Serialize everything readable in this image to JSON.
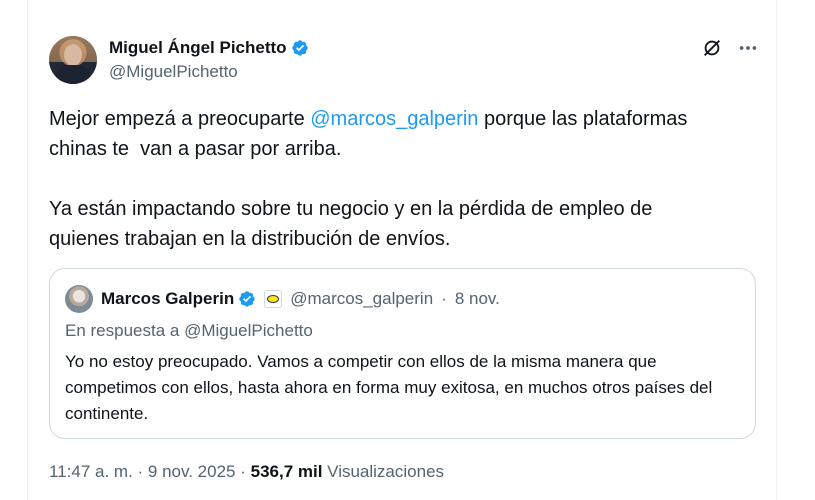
{
  "author": {
    "display_name": "Miguel Ángel Pichetto",
    "handle": "@MiguelPichetto"
  },
  "tweet": {
    "text_part1": "Mejor empezá a preocuparte ",
    "mention": "@marcos_galperin",
    "text_part2": " porque las plataformas\nchinas te  van a pasar por arriba.\n\nYa están impactando sobre tu negocio y en la pérdida de empleo de\nquienes trabajan en la distribución de envíos."
  },
  "quoted": {
    "display_name": "Marcos Galperin",
    "handle": "@marcos_galperin",
    "separator": "·",
    "date": "8 nov.",
    "reply_prefix": "En respuesta a ",
    "reply_to": "@MiguelPichetto",
    "text": "Yo no estoy preocupado. Vamos a competir con ellos de la misma manera que competimos con ellos, hasta ahora en forma muy exitosa, en muchos otros países del continente."
  },
  "meta": {
    "time": "11:47 a. m.",
    "sep1": " · ",
    "date": "9 nov. 2025",
    "sep2": " · ",
    "views_count": "536,7 mil",
    "views_label": " Visualizaciones"
  },
  "icons": {
    "verified": "verified-badge-icon",
    "grok": "grok-icon",
    "more": "more-icon",
    "affiliate": "affiliate-badge-icon"
  },
  "colors": {
    "accent": "#1d9bf0",
    "text": "#0f1419",
    "muted": "#536471",
    "border": "#cfd9de"
  }
}
